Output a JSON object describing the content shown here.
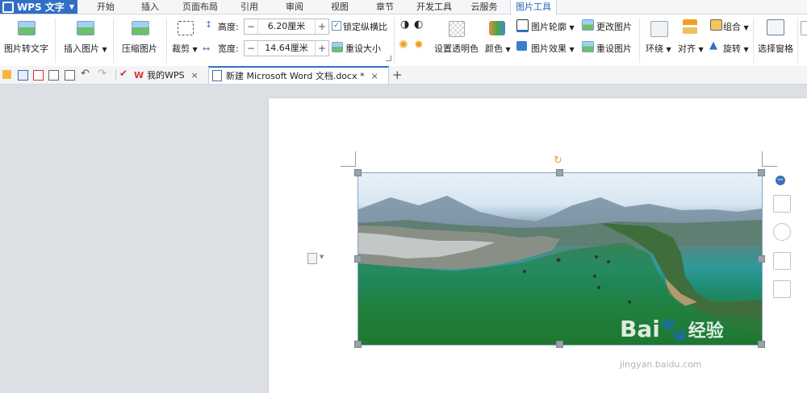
{
  "app": {
    "title": "WPS 文字"
  },
  "menu": {
    "tabs": [
      "开始",
      "插入",
      "页面布局",
      "引用",
      "审阅",
      "视图",
      "章节",
      "开发工具",
      "云服务",
      "图片工具"
    ],
    "active": "图片工具"
  },
  "ribbon": {
    "pic_to_text": "图片转文字",
    "insert_pic": "插入图片",
    "compress_pic": "压缩图片",
    "crop": "裁剪",
    "height_label": "高度:",
    "height_value": "6.20厘米",
    "width_label": "宽度:",
    "width_value": "14.64厘米",
    "lock_ratio": "锁定纵横比",
    "reset_size": "重设大小",
    "set_transparent": "设置透明色",
    "color": "颜色",
    "pic_outline": "图片轮廓",
    "pic_effect": "图片效果",
    "change_pic": "更改图片",
    "reset_pic": "重设图片",
    "wrap": "环绕",
    "align": "对齐",
    "group": "组合",
    "rotate": "旋转",
    "selection_pane": "选择窗格"
  },
  "tabs": {
    "my_wps": "我的WPS",
    "doc": "新建 Microsoft Word 文档.docx *",
    "close": "×",
    "add": "+"
  },
  "watermark": {
    "brand": "Bai",
    "brand_cn": "经验",
    "url": "jingyan.baidu.com"
  },
  "colors": {
    "app_blue": "#2f6fc5",
    "active_tab": "#2a62b8"
  }
}
